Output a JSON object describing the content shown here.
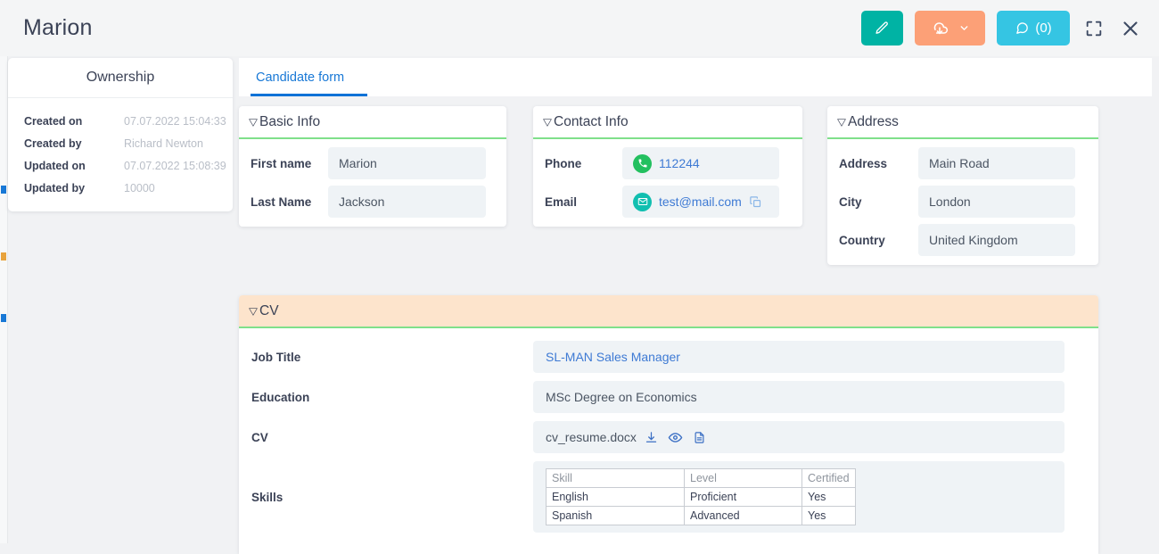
{
  "header": {
    "title": "Marion",
    "buttons": {
      "edit": {
        "icon": "pencil-icon",
        "color": "#00b3a4"
      },
      "download": {
        "icon": "cloud-download-icon",
        "chevron": "chevron-down-icon",
        "color": "#fca077"
      },
      "notes": {
        "icon": "comment-icon",
        "label": "(0)",
        "color": "#35c5e3"
      },
      "fullscreen": {
        "icon": "fullscreen-icon"
      },
      "close": {
        "icon": "close-icon"
      }
    }
  },
  "ownership": {
    "title": "Ownership",
    "rows": [
      {
        "label": "Created on",
        "value": "07.07.2022 15:04:33"
      },
      {
        "label": "Created by",
        "value": "Richard Newton"
      },
      {
        "label": "Updated on",
        "value": "07.07.2022 15:08:39"
      },
      {
        "label": "Updated by",
        "value": "10000"
      }
    ]
  },
  "tabs": [
    {
      "label": "Candidate form",
      "active": true
    }
  ],
  "cards": {
    "basic": {
      "title": "Basic Info",
      "caret": "▽",
      "fields": [
        {
          "label": "First name",
          "value": "Marion"
        },
        {
          "label": "Last Name",
          "value": "Jackson"
        }
      ]
    },
    "contact": {
      "title": "Contact Info",
      "caret": "▽",
      "phone": {
        "label": "Phone",
        "value": "112244",
        "icon": "phone-icon"
      },
      "email": {
        "label": "Email",
        "value": "test@mail.com",
        "icon": "envelope-icon",
        "copy_icon": "copy-icon"
      }
    },
    "address": {
      "title": "Address",
      "caret": "▽",
      "fields": [
        {
          "label": "Address",
          "value": "Main Road"
        },
        {
          "label": "City",
          "value": "London"
        },
        {
          "label": "Country",
          "value": "United Kingdom"
        }
      ]
    },
    "cv": {
      "title": "CV",
      "caret": "▽",
      "job_title": {
        "label": "Job Title",
        "value": "SL-MAN Sales Manager"
      },
      "education": {
        "label": "Education",
        "value": "MSc Degree on Economics"
      },
      "file": {
        "label": "CV",
        "value": "cv_resume.docx",
        "icons": [
          "download-icon",
          "eye-icon",
          "document-icon"
        ]
      },
      "skills": {
        "label": "Skills",
        "columns": [
          "Skill",
          "Level",
          "Certified"
        ],
        "rows": [
          [
            "English",
            "Proficient",
            "Yes"
          ],
          [
            "Spanish",
            "Advanced",
            "Yes"
          ]
        ]
      }
    }
  },
  "colors": {
    "accent_blue": "#0e72d7",
    "teal": "#00b3a4",
    "orange": "#fca077",
    "cyan": "#35c5e3",
    "green_rule": "#7fe08a",
    "cv_header_bg": "#fde4cc"
  },
  "rail_marks": [
    "#1878d6",
    "#e8a33d",
    "#1878d6"
  ]
}
